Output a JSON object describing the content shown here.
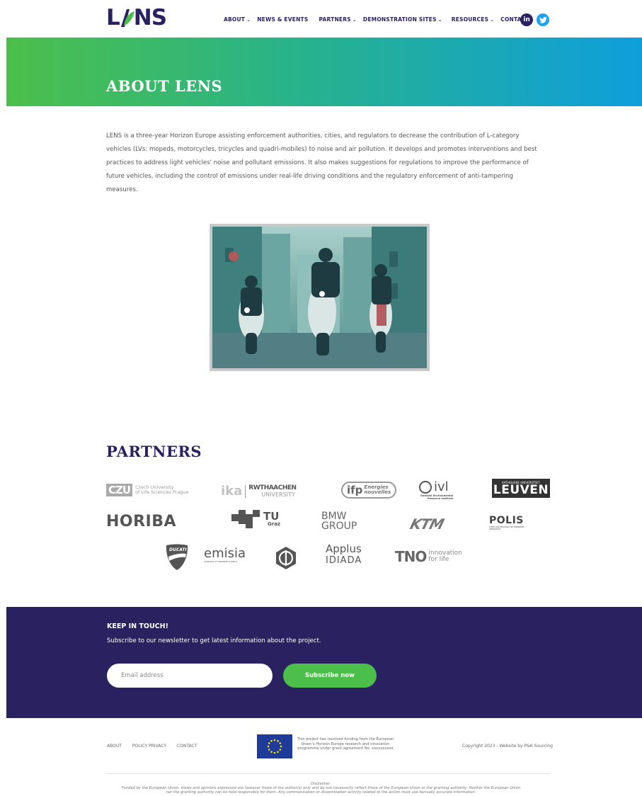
{
  "header": {
    "logo_text": "NS",
    "logo_prefix": "L",
    "nav": [
      {
        "label": "ABOUT",
        "has_dropdown": true
      },
      {
        "label": "NEWS & EVENTS",
        "has_dropdown": false
      },
      {
        "label": "PARTNERS",
        "has_dropdown": true
      },
      {
        "label": "DEMONSTRATION SITES",
        "has_dropdown": true
      },
      {
        "label": "RESOURCES",
        "has_dropdown": true
      },
      {
        "label": "CONTACT",
        "has_dropdown": false
      }
    ],
    "social": {
      "linkedin": "in",
      "twitter": "twitter-icon"
    }
  },
  "hero": {
    "title": "ABOUT LENS"
  },
  "intro": {
    "text": "LENS is a three-year Horizon Europe assisting enforcement authorities, cities, and regulators to decrease the contribution of L-category vehicles (LVs: mopeds, motorcycles, tricycles and quadri-mobiles) to noise and air pollution. It develops and promotes interventions and best practices to address light vehicles' noise and pollutant emissions. It also makes suggestions for regulations to improve the performance of future vehicles, including the control of emissions under real-life driving conditions and the regulatory enforcement of anti-tampering measures."
  },
  "partners": {
    "title": "PARTNERS",
    "logos": {
      "czu": {
        "mark": "CZU",
        "line1": "Czech University",
        "line2": "of Life Sciences Prague"
      },
      "rwth": {
        "ika": "ika",
        "rwth": "RWTHAACHEN",
        "univ": "UNIVERSITY"
      },
      "ifp": {
        "mark": "ifp",
        "line1": "Énergies",
        "line2": "nouvelles"
      },
      "ivl": {
        "mark": "ivl",
        "line1": "Swedish Environmental",
        "line2": "Research Institute"
      },
      "leuven": {
        "top": "KATHOLIEKE UNIVERSITEIT",
        "main": "LEUVEN"
      },
      "horiba": {
        "mark": "HORIBA"
      },
      "tugraz": {
        "mark": "TU",
        "sub": "Graz"
      },
      "bmw": {
        "line1": "BMW",
        "line2": "GROUP"
      },
      "ktm": {
        "mark": "KTM"
      },
      "polis": {
        "mark": "POLIS",
        "sub": "CITIES AND REGIONS FOR TRANSPORT INNOVATION"
      },
      "ducati": {
        "mark": "DUCATI"
      },
      "emisia": {
        "mark": "emisia",
        "sub": "GUARDIAN OF TRANSPORT'S IMPACT"
      },
      "applus": {
        "line1": "Applus",
        "line2": "IDIADA"
      },
      "tno": {
        "mark": "TNO",
        "line1": "innovation",
        "line2": "for life"
      }
    }
  },
  "newsletter": {
    "title": "KEEP IN TOUCH!",
    "subtitle": "Subscribe to our newsletter to get latest information about the project.",
    "email_placeholder": "Email address",
    "button_label": "Subscribe now"
  },
  "footer": {
    "links": [
      "ABOUT",
      "POLICY PRIVACY",
      "CONTACT"
    ],
    "eu_text": "This project has received funding from the European Union's Horizon Europe research and innovation programme under grant agreement No. xxxxxxxxxx",
    "copyright": "Copyright 2023 - Website by P&K Sourcing",
    "disclaimer_title": "Disclaimer:",
    "disclaimer": "Funded by the European Union. Views and opinions expressed are however those of the author(s) only and do not necessarily reflect those of the European Union or the granting authority. Neither the European Union nor the granting authority can be held responsible for them. Any communication or dissemination activity related to the action must use factually accurate information."
  },
  "colors": {
    "brand_navy": "#2a2160",
    "brand_green": "#4cbf4a",
    "brand_blue": "#0f9fdc"
  }
}
